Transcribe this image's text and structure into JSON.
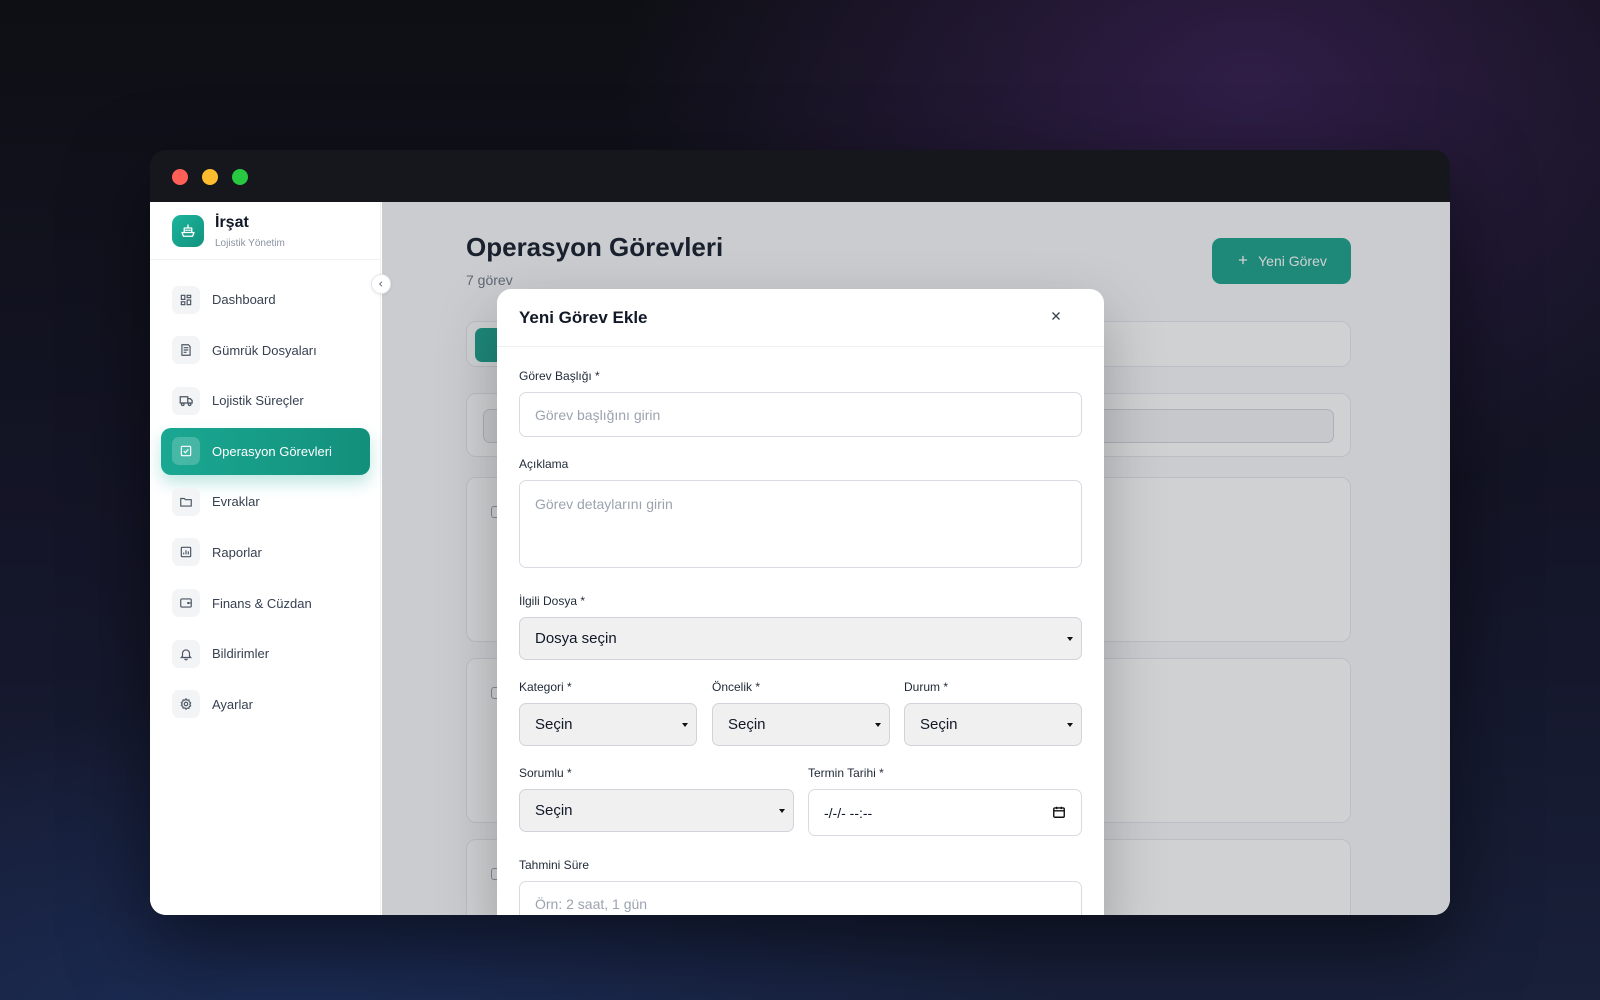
{
  "window": {
    "controls": [
      "close",
      "minimize",
      "maximize"
    ]
  },
  "brand": {
    "name": "İrşat",
    "subtitle": "Lojistik Yönetim",
    "icon": "ship-icon",
    "color": "#16a089"
  },
  "sidebar": {
    "items": [
      {
        "label": "Dashboard",
        "icon": "grid-icon",
        "active": false
      },
      {
        "label": "Gümrük Dosyaları",
        "icon": "document-icon",
        "active": false
      },
      {
        "label": "Lojistik Süreçler",
        "icon": "truck-icon",
        "active": false
      },
      {
        "label": "Operasyon Görevleri",
        "icon": "check-square-icon",
        "active": true
      },
      {
        "label": "Evraklar",
        "icon": "folder-icon",
        "active": false
      },
      {
        "label": "Raporlar",
        "icon": "bar-chart-icon",
        "active": false
      },
      {
        "label": "Finans & Cüzdan",
        "icon": "wallet-icon",
        "active": false
      },
      {
        "label": "Bildirimler",
        "icon": "bell-icon",
        "active": false
      },
      {
        "label": "Ayarlar",
        "icon": "gear-icon",
        "active": false
      }
    ]
  },
  "main": {
    "title": "Operasyon Görevleri",
    "count": "7 görev",
    "new_button": "Yeni Görev"
  },
  "modal": {
    "title": "Yeni Görev Ekle",
    "fields": {
      "title_label": "Görev Başlığı *",
      "title_placeholder": "Görev başlığını girin",
      "description_label": "Açıklama",
      "description_placeholder": "Görev detaylarını girin",
      "file_label": "İlgili Dosya *",
      "file_value": "Dosya seçin",
      "category_label": "Kategori *",
      "category_value": "Seçin",
      "priority_label": "Öncelik *",
      "priority_value": "Seçin",
      "status_label": "Durum *",
      "status_value": "Seçin",
      "assignee_label": "Sorumlu *",
      "assignee_value": "Seçin",
      "due_label": "Termin Tarihi *",
      "due_value": "-/-/- --:--",
      "estimate_label": "Tahmini Süre",
      "estimate_placeholder": "Örn: 2 saat, 1 gün"
    }
  }
}
